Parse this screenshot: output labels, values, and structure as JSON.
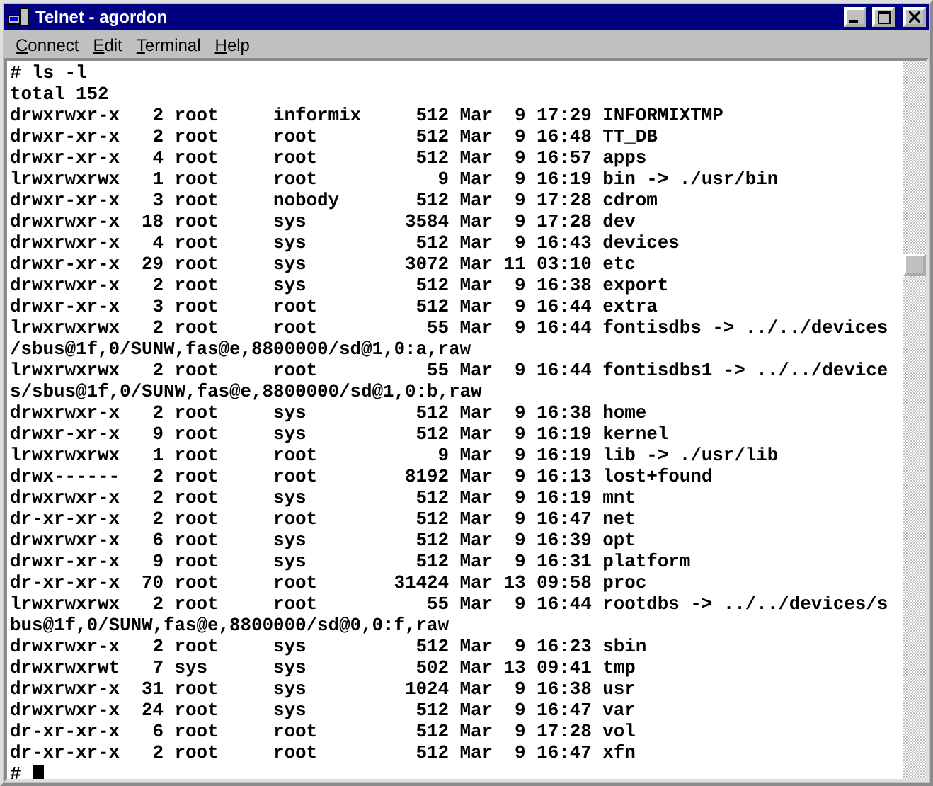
{
  "window": {
    "title": "Telnet - agordon"
  },
  "menu": [
    "Connect",
    "Edit",
    "Terminal",
    "Help"
  ],
  "terminal": {
    "lines": [
      "# ls -l",
      "total 152",
      "drwxrwxr-x   2 root     informix     512 Mar  9 17:29 INFORMIXTMP",
      "drwxr-xr-x   2 root     root         512 Mar  9 16:48 TT_DB",
      "drwxr-xr-x   4 root     root         512 Mar  9 16:57 apps",
      "lrwxrwxrwx   1 root     root           9 Mar  9 16:19 bin -> ./usr/bin",
      "drwxr-xr-x   3 root     nobody       512 Mar  9 17:28 cdrom",
      "drwxrwxr-x  18 root     sys         3584 Mar  9 17:28 dev",
      "drwxrwxr-x   4 root     sys          512 Mar  9 16:43 devices",
      "drwxr-xr-x  29 root     sys         3072 Mar 11 03:10 etc",
      "drwxrwxr-x   2 root     sys          512 Mar  9 16:38 export",
      "drwxr-xr-x   3 root     root         512 Mar  9 16:44 extra",
      "lrwxrwxrwx   2 root     root          55 Mar  9 16:44 fontisdbs -> ../../devices",
      "/sbus@1f,0/SUNW,fas@e,8800000/sd@1,0:a,raw",
      "lrwxrwxrwx   2 root     root          55 Mar  9 16:44 fontisdbs1 -> ../../device",
      "s/sbus@1f,0/SUNW,fas@e,8800000/sd@1,0:b,raw",
      "drwxrwxr-x   2 root     sys          512 Mar  9 16:38 home",
      "drwxr-xr-x   9 root     sys          512 Mar  9 16:19 kernel",
      "lrwxrwxrwx   1 root     root           9 Mar  9 16:19 lib -> ./usr/lib",
      "drwx------   2 root     root        8192 Mar  9 16:13 lost+found",
      "drwxrwxr-x   2 root     sys          512 Mar  9 16:19 mnt",
      "dr-xr-xr-x   2 root     root         512 Mar  9 16:47 net",
      "drwxrwxr-x   6 root     sys          512 Mar  9 16:39 opt",
      "drwxr-xr-x   9 root     sys          512 Mar  9 16:31 platform",
      "dr-xr-xr-x  70 root     root       31424 Mar 13 09:58 proc",
      "lrwxrwxrwx   2 root     root          55 Mar  9 16:44 rootdbs -> ../../devices/s",
      "bus@1f,0/SUNW,fas@e,8800000/sd@0,0:f,raw",
      "drwxrwxr-x   2 root     sys          512 Mar  9 16:23 sbin",
      "drwxrwxrwt   7 sys      sys          502 Mar 13 09:41 tmp",
      "drwxrwxr-x  31 root     sys         1024 Mar  9 16:38 usr",
      "drwxrwxr-x  24 root     sys          512 Mar  9 16:47 var",
      "dr-xr-xr-x   6 root     root         512 Mar  9 17:28 vol",
      "dr-xr-xr-x   2 root     root         512 Mar  9 16:47 xfn"
    ],
    "prompt": "#"
  }
}
